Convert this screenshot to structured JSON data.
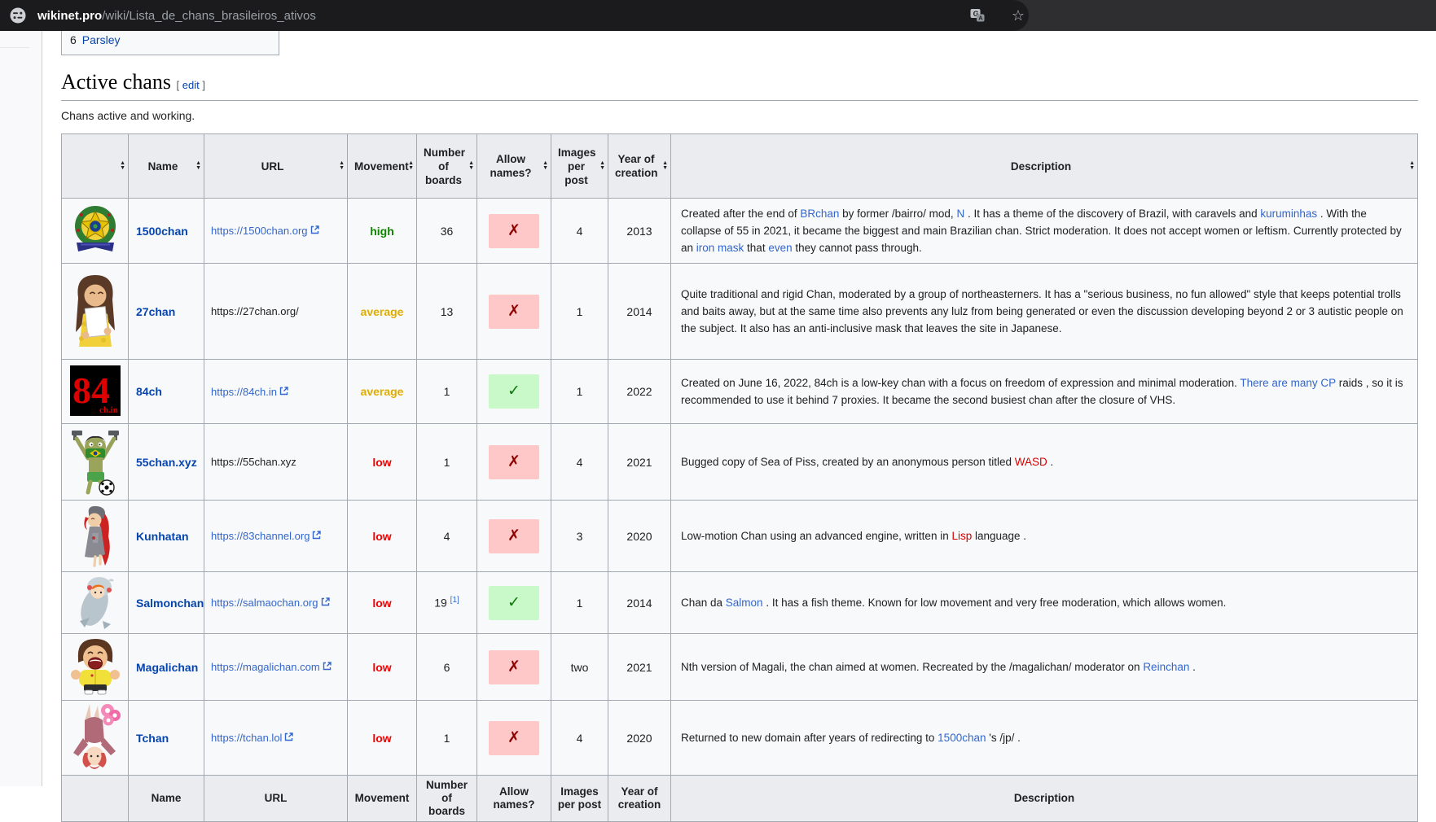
{
  "browser": {
    "url_host": "wikinet.pro",
    "url_path": "/wiki/Lista_de_chans_brasileiros_ativos",
    "icons": {
      "site_info": "page-info-sliders-circle",
      "translate": "translate-icon",
      "bookmark": "star-outline"
    }
  },
  "toc": {
    "item_number": "6",
    "item_label": "Parsley"
  },
  "page": {
    "section_title": "Active chans",
    "edit_label": "edit",
    "edit_bracket_open": "[",
    "edit_bracket_close": "]",
    "intro": "Chans active and working."
  },
  "colors": {
    "name_link": "#0645ad",
    "url_link": "#3366cc",
    "red_link": "#d40000",
    "movement_high": "#0f8500",
    "movement_average": "#e0ac00",
    "movement_low": "#f00000",
    "allow_no_bg": "#ffc8c8",
    "allow_no_glyph": "#8f0000",
    "allow_yes_bg": "#c9f8c9",
    "allow_yes_glyph": "#0c7a0c",
    "header_bg": "#eaecf0",
    "row_bg": "#f8f9fa",
    "table_border": "#a2a9b1"
  },
  "icons": {
    "sort": "▲▼",
    "external_link": "↗",
    "cross": "✗",
    "check": "✓"
  },
  "table": {
    "headers": [
      "",
      "Name",
      "URL",
      "Movement",
      "Number of boards",
      "Allow names?",
      "Images per post",
      "Year of creation",
      "Description"
    ],
    "footer": [
      "",
      "Name",
      "URL",
      "Movement",
      "Number of boards",
      "Allow names?",
      "Images per post",
      "Year of creation",
      "Description"
    ],
    "rows": [
      {
        "logo": "brazil-imperial-coat-of-arms",
        "name": "1500chan",
        "url": "https://1500chan.org",
        "url_is_link": true,
        "movement": "high",
        "boards": "36",
        "allow": "no",
        "allow_glyph": "✗",
        "images": "4",
        "year": "2013",
        "description": [
          {
            "t": "Created after the end of "
          },
          {
            "t": "BRchan",
            "c": "lnk"
          },
          {
            "t": " by former /bairro/ mod, "
          },
          {
            "t": "N",
            "c": "lnk"
          },
          {
            "t": " . It has a theme of the discovery of Brazil, with caravels and "
          },
          {
            "t": "kuruminhas",
            "c": "lnk"
          },
          {
            "t": " . With the collapse of 55 in 2021, it became the biggest and main Brazilian chan. Strict moderation. It does not accept women or leftism. Currently protected by an "
          },
          {
            "t": "iron mask",
            "c": "lnk"
          },
          {
            "t": " that "
          },
          {
            "t": "even",
            "c": "lnk"
          },
          {
            "t": " they cannot pass through."
          }
        ]
      },
      {
        "logo": "girl-holding-paper",
        "name": "27chan",
        "url": "https://27chan.org/",
        "url_is_link": false,
        "movement": "average",
        "boards": "13",
        "allow": "no",
        "allow_glyph": "✗",
        "images": "1",
        "year": "2014",
        "description": [
          {
            "t": "Quite traditional and rigid Chan, moderated by a group of northeasterners. It has a \"serious business, no fun allowed\" style that keeps potential trolls and baits away, but at the same time also prevents any lulz from being generated or even the discussion developing beyond 2 or 3 autistic people on the subject. It also has an anti-inclusive mask that leaves the site in Japanese."
          }
        ]
      },
      {
        "logo": "black-square-red-84",
        "name": "84ch",
        "url": "https://84ch.in",
        "url_is_link": true,
        "movement": "average",
        "boards": "1",
        "allow": "yes",
        "allow_glyph": "✓",
        "images": "1",
        "year": "2022",
        "description": [
          {
            "t": "Created on June 16, 2022, 84ch is a low-key chan with a focus on freedom of expression and minimal moderation. "
          },
          {
            "t": "There are many CP",
            "c": "lnk"
          },
          {
            "t": " raids , so it is recommended to use it behind 7 proxies. It became the second busiest chan after the closure of VHS."
          }
        ]
      },
      {
        "logo": "green-kid-flag-mask-guns-soccer-ball",
        "name": "55chan.xyz",
        "url": "https://55chan.xyz",
        "url_is_link": false,
        "movement": "low",
        "boards": "1",
        "allow": "no",
        "allow_glyph": "✗",
        "images": "4",
        "year": "2021",
        "description": [
          {
            "t": "Bugged copy of Sea of Piss, created by an anonymous person titled "
          },
          {
            "t": "WASD",
            "c": "redlnk"
          },
          {
            "t": " ."
          }
        ]
      },
      {
        "logo": "red-haired-girl-gray-dress",
        "name": "Kunhatan",
        "url": "https://83channel.org",
        "url_is_link": true,
        "movement": "low",
        "boards": "4",
        "allow": "no",
        "allow_glyph": "✗",
        "images": "3",
        "year": "2020",
        "description": [
          {
            "t": "Low-motion Chan using an advanced engine, written in "
          },
          {
            "t": "Lisp",
            "c": "redlnk"
          },
          {
            "t": " language ."
          }
        ]
      },
      {
        "logo": "girl-in-salmon-fish-costume",
        "name": "Salmonchan",
        "url": "https://salmaochan.org",
        "url_is_link": true,
        "movement": "low",
        "boards": "19",
        "boards_ref": "[1]",
        "allow": "yes",
        "allow_glyph": "✓",
        "images": "1",
        "year": "2014",
        "description": [
          {
            "t": "Chan da "
          },
          {
            "t": "Salmon",
            "c": "lnk"
          },
          {
            "t": " . It has a fish theme. Known for low movement and very free moderation, which allows women."
          }
        ]
      },
      {
        "logo": "cheering-kid-yellow-jacket",
        "name": "Magalichan",
        "url": "https://magalichan.com",
        "url_is_link": true,
        "movement": "low",
        "boards": "6",
        "allow": "no",
        "allow_glyph": "✗",
        "images": "two",
        "year": "2021",
        "description": [
          {
            "t": "Nth version of Magali, the chan aimed at women. Recreated by the /magalichan/ moderator on "
          },
          {
            "t": "Reinchan",
            "c": "lnk"
          },
          {
            "t": " ."
          }
        ]
      },
      {
        "logo": "upside-down-pink-haired-girl",
        "name": "Tchan",
        "url": "https://tchan.lol",
        "url_is_link": true,
        "movement": "low",
        "boards": "1",
        "allow": "no",
        "allow_glyph": "✗",
        "images": "4",
        "year": "2020",
        "description": [
          {
            "t": "Returned to new domain after years of redirecting to "
          },
          {
            "t": "1500chan",
            "c": "lnk"
          },
          {
            "t": " 's /jp/ ."
          }
        ]
      }
    ]
  }
}
